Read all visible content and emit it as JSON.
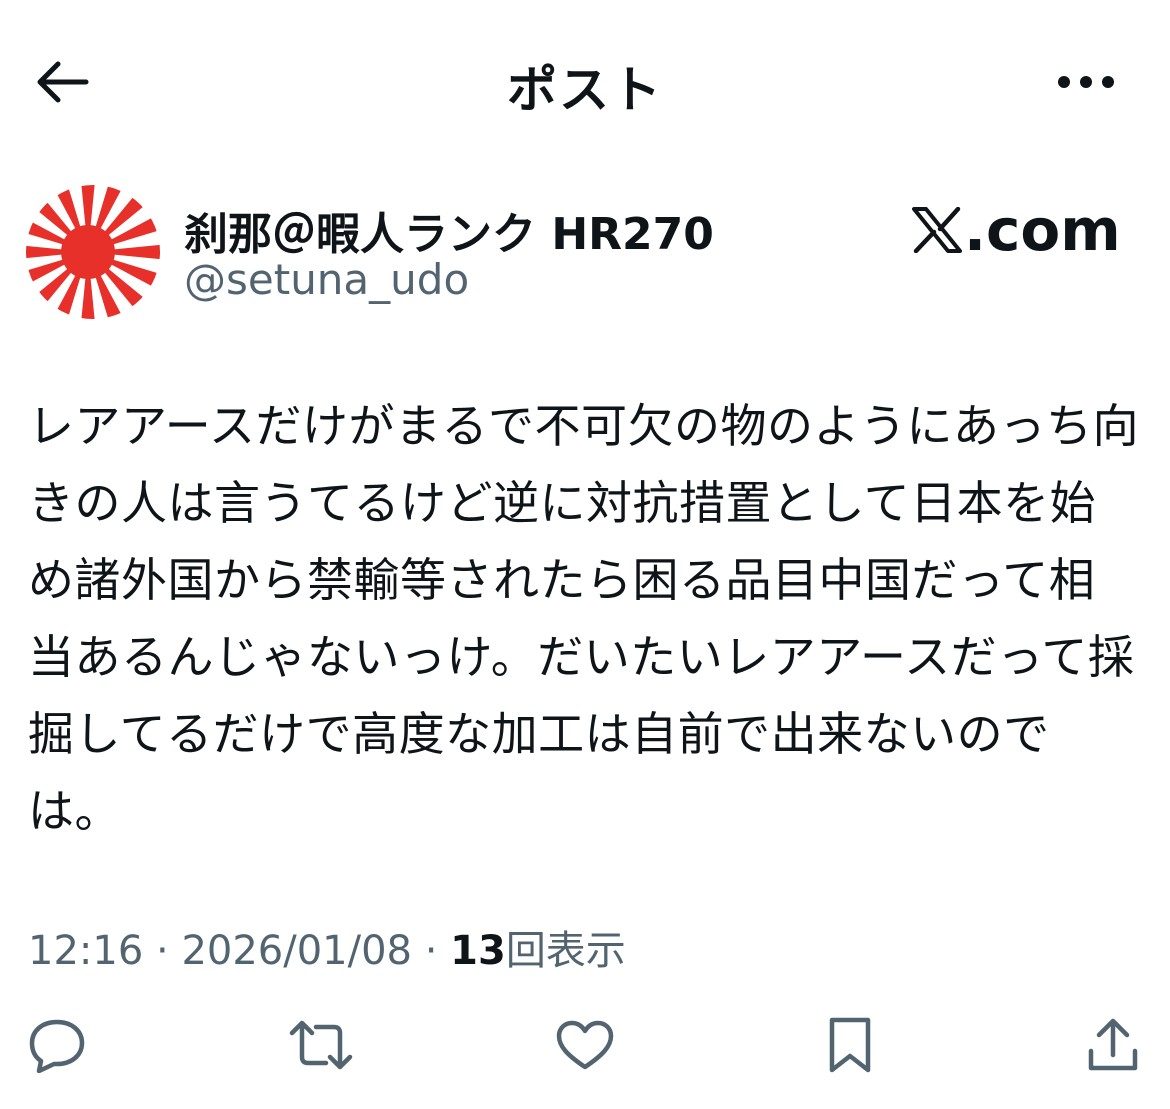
{
  "header": {
    "title": "ポスト",
    "back_icon": "arrow-left-icon",
    "more_icon": "more-horizontal-icon"
  },
  "author": {
    "display_name": "刹那＠暇人ランク HR270",
    "handle": "@setuna_udo",
    "avatar_icon": "rising-sun-flag-avatar"
  },
  "watermark": {
    "text": ".com",
    "icon": "x-logo-icon"
  },
  "post": {
    "text": "レアアースだけがまるで不可欠の物のようにあっち向きの人は言うてるけど逆に対抗措置として日本を始め諸外国から禁輸等されたら困る品目中国だって相当あるんじゃないっけ。だいたいレアアースだって採掘してるだけで高度な加工は自前で出来ないのでは。"
  },
  "meta": {
    "time": "12:16",
    "separator": " · ",
    "date": "2026/01/08",
    "views_count": "13",
    "views_label": "回表示"
  },
  "actions": [
    {
      "icon": "reply-icon"
    },
    {
      "icon": "repost-icon"
    },
    {
      "icon": "like-icon"
    },
    {
      "icon": "bookmark-icon"
    },
    {
      "icon": "share-icon"
    }
  ],
  "colors": {
    "text_primary": "#0f1419",
    "text_secondary": "#536471",
    "avatar_red": "#e8302a",
    "background": "#ffffff"
  }
}
